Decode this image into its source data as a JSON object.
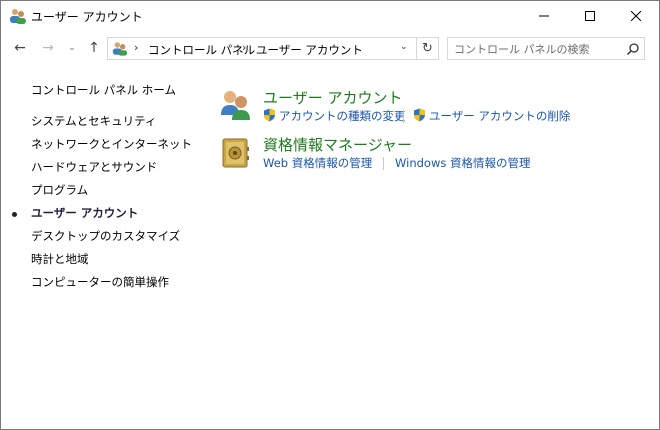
{
  "window": {
    "title": "ユーザー アカウント",
    "minimize_glyph": "—",
    "maximize_glyph": "☐",
    "close_glyph": "✕"
  },
  "nav": {
    "back_glyph": "←",
    "forward_glyph": "→",
    "recent_glyph": "⌄",
    "up_glyph": "↑",
    "refresh_glyph": "↻"
  },
  "address": {
    "breadcrumbs": [
      "コントロール パネル",
      "ユーザー アカウント"
    ],
    "separator": "›",
    "dropdown_glyph": "⌄"
  },
  "search": {
    "placeholder": "コントロール パネルの検索"
  },
  "sidebar": {
    "home": "コントロール パネル ホーム",
    "items": [
      "システムとセキュリティ",
      "ネットワークとインターネット",
      "ハードウェアとサウンド",
      "プログラム",
      "ユーザー アカウント",
      "デスクトップのカスタマイズ",
      "時計と地域",
      "コンピューターの簡単操作"
    ],
    "current_index": 4
  },
  "categories": [
    {
      "title": "ユーザー アカウント",
      "icon": "users-icon",
      "tasks": [
        "アカウントの種類の変更",
        "ユーザー アカウントの削除"
      ]
    },
    {
      "title": "資格情報マネージャー",
      "icon": "credential-vault-icon",
      "tasks": [
        "Web 資格情報の管理",
        "Windows 資格情報の管理"
      ]
    }
  ],
  "colors": {
    "category_title": "#1e7b1e",
    "task_link": "#1a55b0",
    "current_item": "#1e1e3c"
  }
}
